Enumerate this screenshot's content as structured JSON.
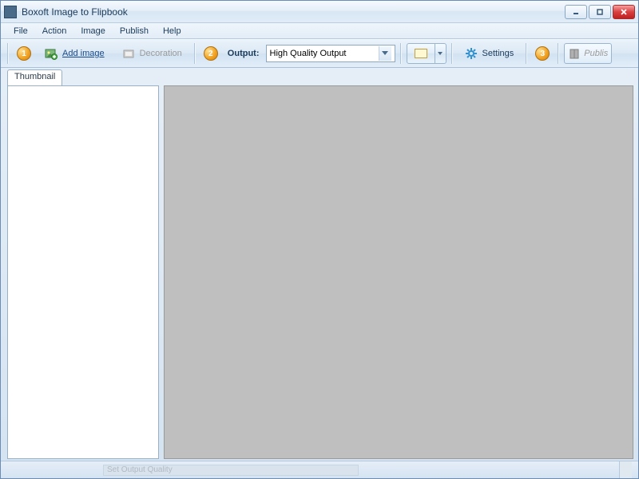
{
  "window": {
    "title": "Boxoft Image to Flipbook"
  },
  "menu": {
    "items": [
      "File",
      "Action",
      "Image",
      "Publish",
      "Help"
    ]
  },
  "toolbar": {
    "step1": "1",
    "add_image_label": "Add image",
    "decoration_label": "Decoration",
    "step2": "2",
    "output_label": "Output:",
    "output_selected": "High Quality Output",
    "settings_label": "Settings",
    "step3": "3",
    "publish_label": "Publis"
  },
  "panel": {
    "tab_label": "Thumbnail"
  },
  "status": {
    "ghost_text": "Set Output Quality"
  }
}
